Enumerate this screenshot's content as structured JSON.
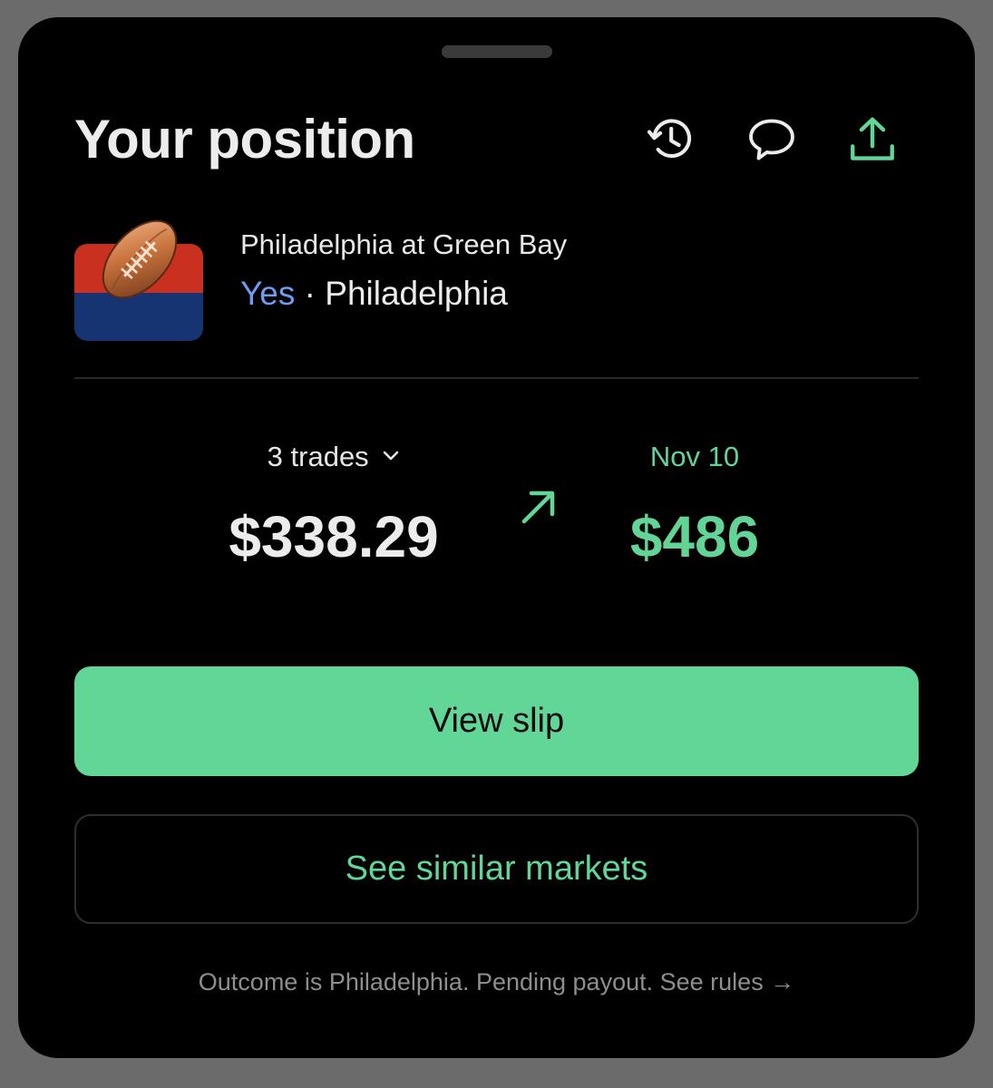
{
  "sheet": {
    "title": "Your position",
    "icons": [
      "history-icon",
      "comment-icon",
      "share-icon"
    ]
  },
  "market": {
    "name": "Philadelphia at Green Bay",
    "side_label": "Yes",
    "separator": "·",
    "team": "Philadelphia",
    "thumbnail_icon": "football-icon"
  },
  "position": {
    "trades_label": "3 trades",
    "cost": "$338.29",
    "payout_date": "Nov 10",
    "payout": "$486"
  },
  "actions": {
    "view_slip": "View slip",
    "similar_markets": "See similar markets"
  },
  "footer": {
    "outcome_text": "Outcome is Philadelphia. Pending payout.",
    "rules_link": "See rules →"
  },
  "colors": {
    "background": "#000000",
    "accent_green": "#61d697",
    "yes_blue": "#6f9cf1",
    "flag_red": "#c9301f",
    "flag_blue": "#173472",
    "muted_text": "#8e8e8e"
  }
}
